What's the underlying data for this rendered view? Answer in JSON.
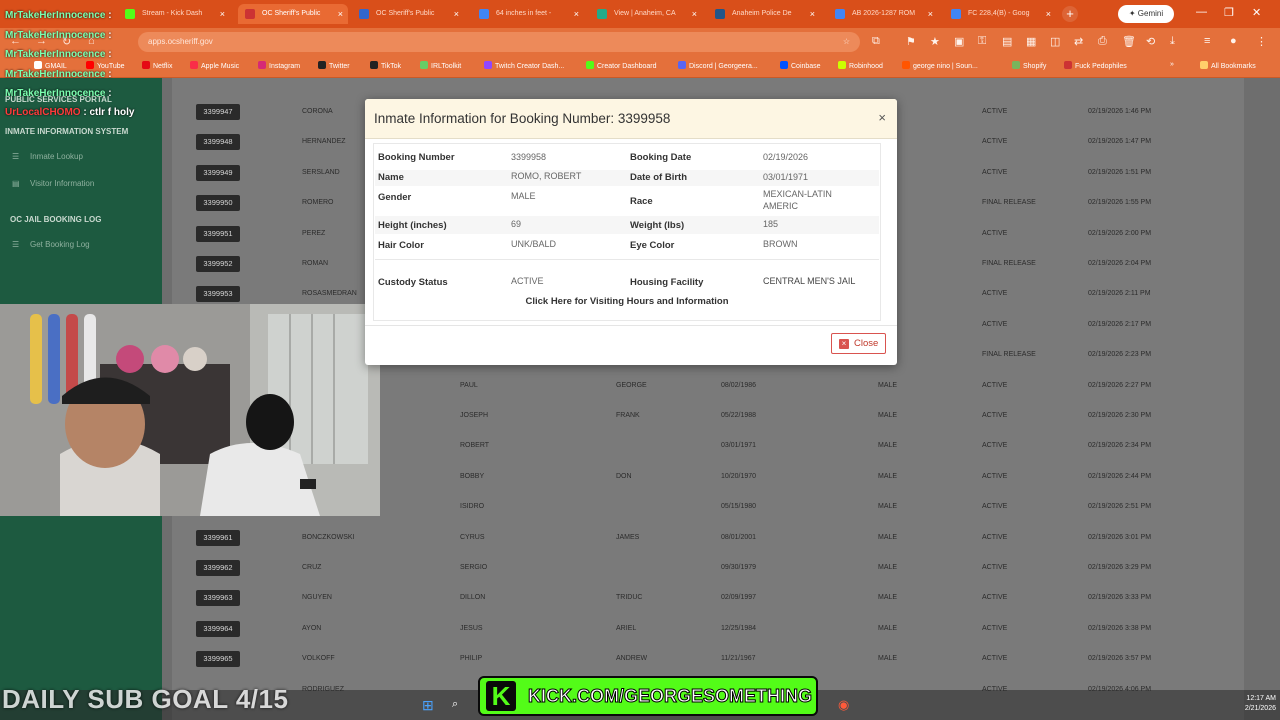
{
  "browser": {
    "tabs": [
      {
        "label": "Stream - Kick Dash",
        "icon_color": "#53fc18",
        "active": false
      },
      {
        "label": "OC Sheriff's Public",
        "icon_color": "#c33",
        "active": true
      },
      {
        "label": "OC Sheriff's Public",
        "icon_color": "#36c",
        "active": false
      },
      {
        "label": "64 inches in feet - ",
        "icon_color": "#4285f4",
        "active": false
      },
      {
        "label": "View | Anaheim, CA",
        "icon_color": "#2a8",
        "active": false
      },
      {
        "label": "Anaheim Police De",
        "icon_color": "#258",
        "active": false
      },
      {
        "label": "AB 2026-1287 ROM",
        "icon_color": "#4285f4",
        "active": false
      },
      {
        "label": "FC 228,4(B) - Goog",
        "icon_color": "#4285f4",
        "active": false
      }
    ],
    "gemini_label": "Gemini",
    "url": "apps.ocsheriff.gov",
    "bookmarks": [
      "GMAIL",
      "YouTube",
      "Netflix",
      "Apple Music",
      "Instagram",
      "Twitter",
      "TikTok",
      "IRLToolkit",
      "Twitch Creator Dash...",
      "Creator Dashboard",
      "Discord | Georgeera...",
      "Coinbase",
      "Robinhood",
      "george nino | Soun...",
      "Shopify",
      "Fuck Pedophiles"
    ],
    "all_bookmarks": "All Bookmarks"
  },
  "sidebar": {
    "portal_title": "PUBLIC SERVICES PORTAL",
    "section1": "INMATE INFORMATION SYSTEM",
    "items1": [
      "Inmate Lookup",
      "Visitor Information"
    ],
    "section2": "OC JAIL BOOKING LOG",
    "items2": [
      "Get Booking Log"
    ]
  },
  "table_rows": [
    {
      "booking": "3399947",
      "last": "CORONA",
      "first": "",
      "middle": "",
      "dob": "",
      "sex": "",
      "status": "ACTIVE",
      "date": "02/19/2026 1:46 PM"
    },
    {
      "booking": "3399948",
      "last": "HERNANDEZ",
      "first": "",
      "middle": "",
      "dob": "",
      "sex": "",
      "status": "ACTIVE",
      "date": "02/19/2026 1:47 PM"
    },
    {
      "booking": "3399949",
      "last": "SERSLAND",
      "first": "",
      "middle": "",
      "dob": "",
      "sex": "",
      "status": "ACTIVE",
      "date": "02/19/2026 1:51 PM"
    },
    {
      "booking": "3399950",
      "last": "ROMERO",
      "first": "",
      "middle": "",
      "dob": "",
      "sex": "",
      "status": "FINAL RELEASE",
      "date": "02/19/2026 1:55 PM"
    },
    {
      "booking": "3399951",
      "last": "PEREZ",
      "first": "",
      "middle": "",
      "dob": "",
      "sex": "",
      "status": "ACTIVE",
      "date": "02/19/2026 2:00 PM"
    },
    {
      "booking": "3399952",
      "last": "ROMAN",
      "first": "",
      "middle": "",
      "dob": "",
      "sex": "",
      "status": "FINAL RELEASE",
      "date": "02/19/2026 2:04 PM"
    },
    {
      "booking": "3399953",
      "last": "ROSASMEDRAN",
      "first": "",
      "middle": "",
      "dob": "",
      "sex": "",
      "status": "ACTIVE",
      "date": "02/19/2026 2:11 PM"
    },
    {
      "booking": "",
      "last": "",
      "first": "",
      "middle": "",
      "dob": "",
      "sex": "",
      "status": "ACTIVE",
      "date": "02/19/2026 2:17 PM"
    },
    {
      "booking": "",
      "last": "",
      "first": "",
      "middle": "",
      "dob": "",
      "sex": "",
      "status": "FINAL RELEASE",
      "date": "02/19/2026 2:23 PM"
    },
    {
      "booking": "",
      "last": "",
      "first": "PAUL",
      "middle": "GEORGE",
      "dob": "08/02/1986",
      "sex": "MALE",
      "status": "ACTIVE",
      "date": "02/19/2026 2:27 PM"
    },
    {
      "booking": "",
      "last": "",
      "first": "JOSEPH",
      "middle": "FRANK",
      "dob": "05/22/1988",
      "sex": "MALE",
      "status": "ACTIVE",
      "date": "02/19/2026 2:30 PM"
    },
    {
      "booking": "",
      "last": "",
      "first": "ROBERT",
      "middle": "",
      "dob": "03/01/1971",
      "sex": "MALE",
      "status": "ACTIVE",
      "date": "02/19/2026 2:34 PM"
    },
    {
      "booking": "",
      "last": "",
      "first": "BOBBY",
      "middle": "DON",
      "dob": "10/20/1970",
      "sex": "MALE",
      "status": "ACTIVE",
      "date": "02/19/2026 2:44 PM"
    },
    {
      "booking": "",
      "last": "",
      "first": "ISIDRO",
      "middle": "",
      "dob": "05/15/1980",
      "sex": "MALE",
      "status": "ACTIVE",
      "date": "02/19/2026 2:51 PM"
    },
    {
      "booking": "3399961",
      "last": "BONCZKOWSKI",
      "first": "CYRUS",
      "middle": "JAMES",
      "dob": "08/01/2001",
      "sex": "MALE",
      "status": "ACTIVE",
      "date": "02/19/2026 3:01 PM"
    },
    {
      "booking": "3399962",
      "last": "CRUZ",
      "first": "SERGIO",
      "middle": "",
      "dob": "09/30/1979",
      "sex": "MALE",
      "status": "ACTIVE",
      "date": "02/19/2026 3:29 PM"
    },
    {
      "booking": "3399963",
      "last": "NGUYEN",
      "first": "DILLON",
      "middle": "TRIDUC",
      "dob": "02/09/1997",
      "sex": "MALE",
      "status": "ACTIVE",
      "date": "02/19/2026 3:33 PM"
    },
    {
      "booking": "3399964",
      "last": "AYON",
      "first": "JESUS",
      "middle": "ARIEL",
      "dob": "12/25/1984",
      "sex": "MALE",
      "status": "ACTIVE",
      "date": "02/19/2026 3:38 PM"
    },
    {
      "booking": "3399965",
      "last": "VOLKOFF",
      "first": "PHILIP",
      "middle": "ANDREW",
      "dob": "11/21/1967",
      "sex": "MALE",
      "status": "ACTIVE",
      "date": "02/19/2026 3:57 PM"
    },
    {
      "booking": "",
      "last": "RODRIGUEZ",
      "first": "",
      "middle": "",
      "dob": "",
      "sex": "",
      "status": "ACTIVE",
      "date": "02/19/2026 4:06 PM"
    }
  ],
  "chat": [
    {
      "user": "MrTakeHerInnocence",
      "msg": ":",
      "red": false
    },
    {
      "user": "MrTakeHerInnocence",
      "msg": ":",
      "red": false
    },
    {
      "user": "MrTakeHerInnocence",
      "msg": ":",
      "red": false
    },
    {
      "user": "MrTakeHerInnocence",
      "msg": ":",
      "red": false
    },
    {
      "user": "MrTakeHerInnocence",
      "msg": ":",
      "red": false
    },
    {
      "user": "UrLocalCHOMO",
      "msg": ": ctlr f holy",
      "red": true
    }
  ],
  "modal": {
    "title": "Inmate Information for Booking Number: 3399958",
    "fields": {
      "booking_number_label": "Booking Number",
      "booking_number": "3399958",
      "booking_date_label": "Booking Date",
      "booking_date": "02/19/2026",
      "name_label": "Name",
      "name": "ROMO, ROBERT",
      "dob_label": "Date of Birth",
      "dob": "03/01/1971",
      "gender_label": "Gender",
      "gender": "MALE",
      "race_label": "Race",
      "race_line1": "MEXICAN-LATIN",
      "race_line2": "AMERIC",
      "height_label": "Height (inches)",
      "height": "69",
      "weight_label": "Weight (lbs)",
      "weight": "185",
      "hair_label": "Hair Color",
      "hair": "UNK/BALD",
      "eye_label": "Eye Color",
      "eye": "BROWN",
      "custody_label": "Custody Status",
      "custody": "ACTIVE",
      "housing_label": "Housing Facility",
      "housing": "CENTRAL MEN'S JAIL"
    },
    "visiting_link": "Click Here for Visiting Hours and Information",
    "close_label": "Close"
  },
  "overlays": {
    "sub_goal": "DAILY SUB GOAL 4/15",
    "kick_text": "KICK.COM/GEORGESOMETHING",
    "kick_letter": "K",
    "clock_time": "12:17 AM",
    "clock_date": "2/21/2026"
  }
}
